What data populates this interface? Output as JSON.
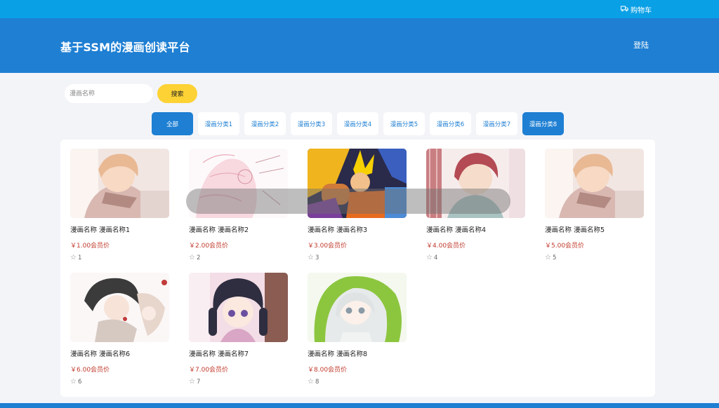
{
  "topbar": {
    "cart_label": "购物车",
    "cart_icon": "truck-icon"
  },
  "header": {
    "site_title": "基于SSM的漫画创读平台",
    "login_label": "登陆"
  },
  "search": {
    "placeholder": "漫画名称",
    "value": "",
    "button_label": "搜索"
  },
  "tabs": [
    {
      "label": "全部",
      "active": true
    },
    {
      "label": "漫画分类1",
      "active": false
    },
    {
      "label": "漫画分类2",
      "active": false
    },
    {
      "label": "漫画分类3",
      "active": false
    },
    {
      "label": "漫画分类4",
      "active": false
    },
    {
      "label": "漫画分类5",
      "active": false
    },
    {
      "label": "漫画分类6",
      "active": false
    },
    {
      "label": "漫画分类7",
      "active": false
    },
    {
      "label": "漫画分类8",
      "active": true
    }
  ],
  "comics": [
    {
      "name": "漫画名称 漫画名称1",
      "price": "￥1.00会员价",
      "favorites": "1",
      "cover_icon": "comic-cover-image"
    },
    {
      "name": "漫画名称 漫画名称2",
      "price": "￥2.00会员价",
      "favorites": "2",
      "cover_icon": "comic-cover-image"
    },
    {
      "name": "漫画名称 漫画名称3",
      "price": "￥3.00会员价",
      "favorites": "3",
      "cover_icon": "comic-cover-image"
    },
    {
      "name": "漫画名称 漫画名称4",
      "price": "￥4.00会员价",
      "favorites": "4",
      "cover_icon": "comic-cover-image"
    },
    {
      "name": "漫画名称 漫画名称5",
      "price": "￥5.00会员价",
      "favorites": "5",
      "cover_icon": "comic-cover-image"
    },
    {
      "name": "漫画名称 漫画名称6",
      "price": "￥6.00会员价",
      "favorites": "6",
      "cover_icon": "comic-cover-image"
    },
    {
      "name": "漫画名称 漫画名称7",
      "price": "￥7.00会员价",
      "favorites": "7",
      "cover_icon": "comic-cover-image"
    },
    {
      "name": "漫画名称 漫画名称8",
      "price": "￥8.00会员价",
      "favorites": "8",
      "cover_icon": "comic-cover-image"
    }
  ],
  "colors": {
    "topbar": "#0aa0e6",
    "header": "#1e7fd3",
    "search_button": "#fdd234",
    "price": "#c0392b",
    "background": "#f3f4f8"
  }
}
